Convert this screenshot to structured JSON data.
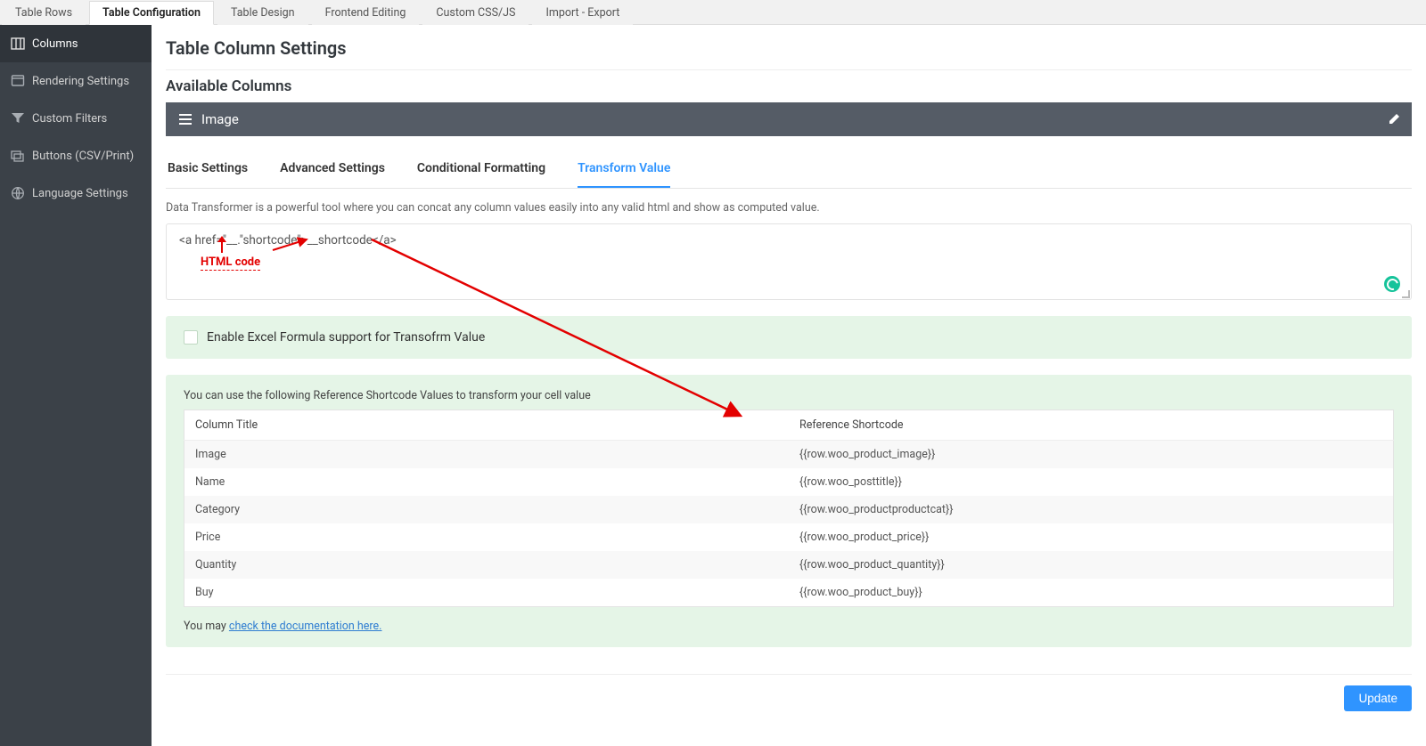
{
  "topTabs": [
    "Table Rows",
    "Table Configuration",
    "Table Design",
    "Frontend Editing",
    "Custom CSS/JS",
    "Import - Export"
  ],
  "topActive": 1,
  "sidebar": {
    "items": [
      {
        "label": "Columns"
      },
      {
        "label": "Rendering Settings"
      },
      {
        "label": "Custom Filters"
      },
      {
        "label": "Buttons (CSV/Print)"
      },
      {
        "label": "Language Settings"
      }
    ],
    "active": 0
  },
  "page": {
    "title": "Table Column Settings",
    "availableColumns": "Available Columns",
    "accordionTitle": "Image"
  },
  "innerTabs": [
    "Basic Settings",
    "Advanced Settings",
    "Conditional Formatting",
    "Transform Value"
  ],
  "innerActive": 3,
  "transform": {
    "helpText": "Data Transformer is a powerful tool where you can concat any column values easily into any valid html and show as computed value.",
    "textareaValue": "<a href=\"__.\"shortcode\">__shortcode</a>",
    "annotationLabel": "HTML code"
  },
  "excelCheckbox": "Enable Excel Formula support for Transofrm Value",
  "refPanel": {
    "intro": "You can use the following Reference Shortcode Values to transform your cell value",
    "headers": [
      "Column Title",
      "Reference Shortcode"
    ],
    "rows": [
      {
        "title": "Image",
        "code": "{{row.woo_product_image}}"
      },
      {
        "title": "Name",
        "code": "{{row.woo_posttitle}}"
      },
      {
        "title": "Category",
        "code": "{{row.woo_productproductcat}}"
      },
      {
        "title": "Price",
        "code": "{{row.woo_product_price}}"
      },
      {
        "title": "Quantity",
        "code": "{{row.woo_product_quantity}}"
      },
      {
        "title": "Buy",
        "code": "{{row.woo_product_buy}}"
      }
    ],
    "docPrefix": "You may ",
    "docLink": "check the documentation here."
  },
  "updateButton": "Update"
}
